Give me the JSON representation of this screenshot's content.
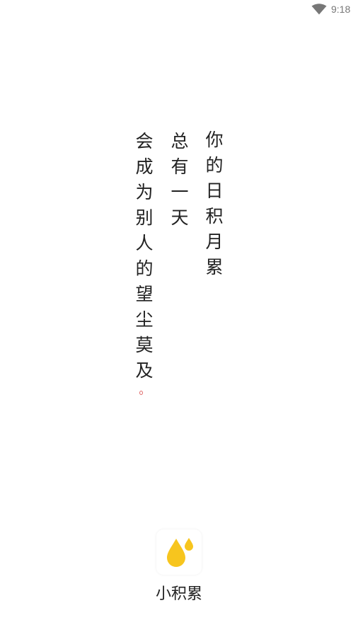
{
  "status_bar": {
    "time": "9:18",
    "wifi_icon": "wifi-icon"
  },
  "poem": {
    "line_1": [
      "你",
      "的",
      "日",
      "积",
      "月",
      "累"
    ],
    "line_2": [
      "总",
      "有",
      "一",
      "天"
    ],
    "line_3": [
      "会",
      "成",
      "为",
      "别",
      "人",
      "的",
      "望",
      "尘",
      "莫",
      "及"
    ]
  },
  "app": {
    "name": "小积累",
    "icon": "water-drops-icon",
    "icon_color": "#f7c51e"
  },
  "colors": {
    "text": "#222222",
    "accent": "#f7c51e",
    "period_mark": "#e06a6a"
  }
}
